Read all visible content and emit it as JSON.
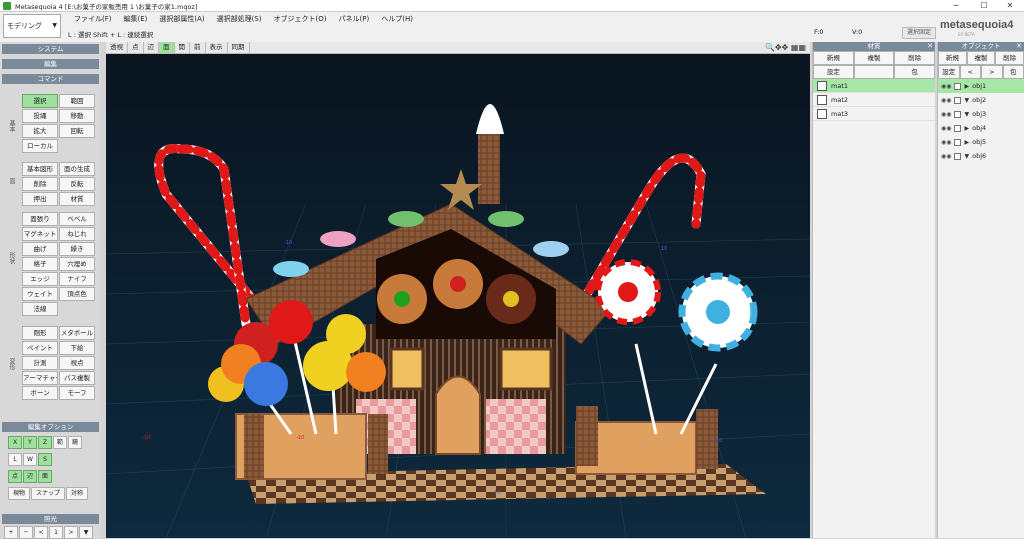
{
  "window": {
    "title": "Metasequoia 4 [E:\\お菓子の家販売用 1 \\お菓子の家1.mqoz]",
    "min": "─",
    "max": "☐",
    "close": "✕"
  },
  "mode_select": {
    "value": "モデリング"
  },
  "menus": [
    "ファイル(F)",
    "編集(E)",
    "選択部属性(A)",
    "選択部処理(S)",
    "オブジェクト(O)",
    "パネル(P)",
    "ヘルプ(H)"
  ],
  "hint": "L : 選択   Shift + L : 連続選択",
  "status": {
    "f": "F:0",
    "v": "V:0",
    "sel_fix": "選択固定"
  },
  "logo": {
    "text": "metasequoia4",
    "sub": "EX BETA"
  },
  "left": {
    "system": "システム",
    "edit": "編集",
    "command": "コマンド",
    "groups": [
      {
        "label": "基本",
        "buttons": [
          [
            "選択",
            true
          ],
          [
            "範囲",
            false
          ],
          [
            "投縄",
            false
          ],
          [
            "移動",
            false
          ],
          [
            "拡大",
            false
          ],
          [
            "回転",
            false
          ],
          [
            "ローカル",
            false
          ]
        ]
      },
      {
        "label": "面",
        "buttons": [
          [
            "基本図形",
            false
          ],
          [
            "面の生成",
            false
          ],
          [
            "削除",
            false
          ],
          [
            "反転",
            false
          ],
          [
            "押出",
            false
          ],
          [
            "材質",
            false
          ]
        ]
      },
      {
        "label": "形状",
        "buttons": [
          [
            "面張り",
            false
          ],
          [
            "ベベル",
            false
          ],
          [
            "マグネット",
            false
          ],
          [
            "ねじれ",
            false
          ],
          [
            "曲げ",
            false
          ],
          [
            "繰き",
            false
          ],
          [
            "格子",
            false
          ],
          [
            "穴埋め",
            false
          ],
          [
            "エッジ",
            false
          ],
          [
            "ナイフ",
            false
          ],
          [
            "ウェイト",
            false
          ],
          [
            "頂点色",
            false
          ],
          [
            "法線",
            false
          ]
        ]
      },
      {
        "label": "変形",
        "buttons": [
          [
            "剛形",
            false
          ],
          [
            "メタボール",
            false
          ],
          [
            "ペイント",
            false
          ],
          [
            "下絵",
            false
          ],
          [
            "計測",
            false
          ],
          [
            "視点",
            false
          ],
          [
            "アーマチャー",
            false
          ],
          [
            "パス複製",
            false
          ],
          [
            "ボーン",
            false
          ],
          [
            "モーフ",
            false
          ]
        ]
      }
    ],
    "edit_options": "編集オプション",
    "axis": [
      [
        "X",
        true
      ],
      [
        "Y",
        true
      ],
      [
        "Z",
        true
      ],
      [
        "範",
        false
      ],
      [
        "鏡",
        false
      ]
    ],
    "lws": [
      [
        "L",
        false
      ],
      [
        "W",
        false
      ],
      [
        "S",
        true
      ]
    ],
    "pes": [
      [
        "点",
        true
      ],
      [
        "辺",
        true
      ],
      [
        "面",
        true
      ]
    ],
    "snap": [
      "現物",
      "スナップ",
      "対称"
    ],
    "lighting": "照光",
    "lighting_ctrl": [
      "+",
      "─",
      "<",
      "1",
      ">",
      "▼"
    ]
  },
  "view_toolbar": [
    [
      "透視",
      false
    ],
    [
      "点",
      false
    ],
    [
      "辺",
      false
    ],
    [
      "面",
      true
    ],
    [
      "開",
      false
    ],
    [
      "前",
      false
    ],
    [
      "表示",
      false
    ],
    [
      "同期",
      false
    ]
  ],
  "view_icons": "🔍✥✥ ▦▦",
  "materials": {
    "title": "材質",
    "row1": [
      "新規",
      "複製",
      "削除"
    ],
    "row2": [
      "設定",
      "",
      "包"
    ],
    "items": [
      [
        "mat1",
        true
      ],
      [
        "mat2",
        false
      ],
      [
        "mat3",
        false
      ]
    ]
  },
  "objects": {
    "title": "オブジェクト",
    "row1": [
      "新規",
      "複製",
      "削除"
    ],
    "row2": [
      "設定",
      "<",
      ">",
      "包"
    ],
    "items": [
      [
        "obj1",
        true,
        "▶"
      ],
      [
        "obj2",
        false,
        "▼"
      ],
      [
        "obj3",
        false,
        "▼"
      ],
      [
        "obj4",
        false,
        "▶"
      ],
      [
        "obj5",
        false,
        "▶"
      ],
      [
        "obj6",
        false,
        "▼"
      ]
    ]
  },
  "scene": {
    "tick_labels": [
      "-10",
      "-10",
      "10",
      "-10",
      "10",
      "10"
    ]
  }
}
